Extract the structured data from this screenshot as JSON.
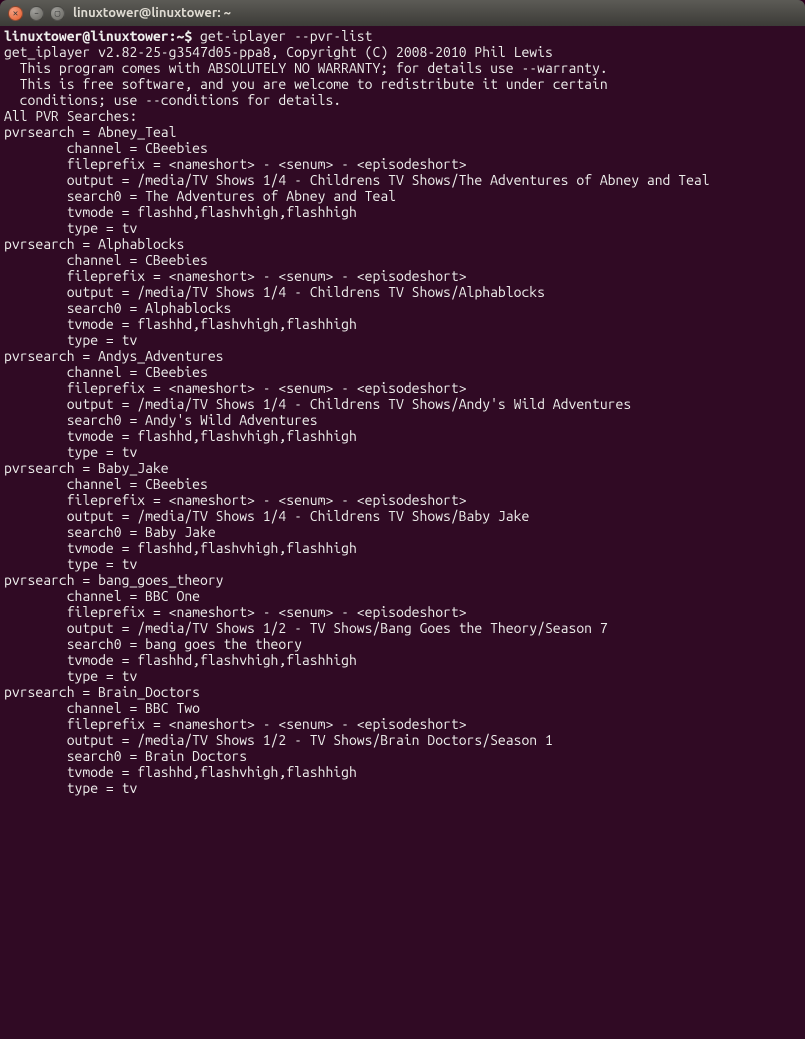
{
  "window": {
    "title": "linuxtower@linuxtower: ~"
  },
  "prompt": "linuxtower@linuxtower:~$ ",
  "command": "get-iplayer --pvr-list",
  "banner": {
    "l1": "get_iplayer v2.82-25-g3547d05-ppa8, Copyright (C) 2008-2010 Phil Lewis",
    "l2": "This program comes with ABSOLUTELY NO WARRANTY; for details use --warranty.",
    "l3": "This is free software, and you are welcome to redistribute it under certain",
    "l4": "conditions; use --conditions for details."
  },
  "section_title": "All PVR Searches:",
  "searches": [
    {
      "name": "Abney_Teal",
      "channel": "CBeebies",
      "fileprefix": "<nameshort> - <senum> - <episodeshort>",
      "output": "/media/TV Shows 1/4 - Childrens TV Shows/The Adventures of Abney and Teal",
      "output_wrap": true,
      "search0": "The Adventures of Abney and Teal",
      "tvmode": "flashhd,flashvhigh,flashhigh",
      "type": "tv"
    },
    {
      "name": "Alphablocks",
      "channel": "CBeebies",
      "fileprefix": "<nameshort> - <senum> - <episodeshort>",
      "output": "/media/TV Shows 1/4 - Childrens TV Shows/Alphablocks",
      "search0": "Alphablocks",
      "tvmode": "flashhd,flashvhigh,flashhigh",
      "type": "tv"
    },
    {
      "name": "Andys_Adventures",
      "channel": "CBeebies",
      "fileprefix": "<nameshort> - <senum> - <episodeshort>",
      "output": "/media/TV Shows 1/4 - Childrens TV Shows/Andy's Wild Adventures",
      "search0": "Andy's Wild Adventures",
      "tvmode": "flashhd,flashvhigh,flashhigh",
      "type": "tv"
    },
    {
      "name": "Baby_Jake",
      "channel": "CBeebies",
      "fileprefix": "<nameshort> - <senum> - <episodeshort>",
      "output": "/media/TV Shows 1/4 - Childrens TV Shows/Baby Jake",
      "search0": "Baby Jake",
      "tvmode": "flashhd,flashvhigh,flashhigh",
      "type": "tv"
    },
    {
      "name": "bang_goes_theory",
      "channel": "BBC One",
      "fileprefix": "<nameshort> - <senum> - <episodeshort>",
      "output": "/media/TV Shows 1/2 - TV Shows/Bang Goes the Theory/Season 7",
      "search0": "bang goes the theory",
      "tvmode": "flashhd,flashvhigh,flashhigh",
      "type": "tv"
    },
    {
      "name": "Brain_Doctors",
      "channel": "BBC Two",
      "fileprefix": "<nameshort> - <senum> - <episodeshort>",
      "output": "/media/TV Shows 1/2 - TV Shows/Brain Doctors/Season 1",
      "search0": "Brain Doctors",
      "tvmode": "flashhd,flashvhigh,flashhigh",
      "type": "tv"
    }
  ],
  "labels": {
    "pvrsearch": "pvrsearch = ",
    "channel": "channel = ",
    "fileprefix": "fileprefix = ",
    "output": "output = ",
    "search0": "search0 = ",
    "tvmode": "tvmode = ",
    "type": "type = "
  }
}
